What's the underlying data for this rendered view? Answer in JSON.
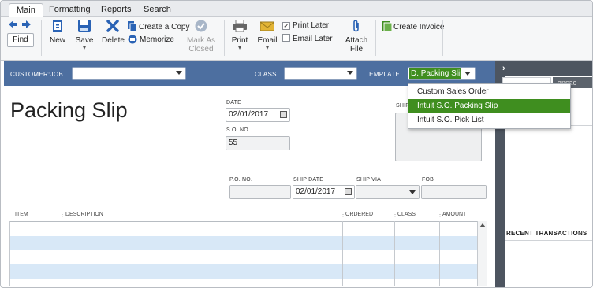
{
  "tabs": [
    "Main",
    "Formatting",
    "Reports",
    "Search"
  ],
  "toolbar": {
    "find": "Find",
    "new": "New",
    "save": "Save",
    "delete": "Delete",
    "create_a_copy": "Create a Copy",
    "memorize": "Memorize",
    "mark_as_closed_1": "Mark As",
    "mark_as_closed_2": "Closed",
    "print": "Print",
    "email": "Email",
    "print_later": "Print Later",
    "email_later": "Email Later",
    "attach_file_1": "Attach",
    "attach_file_2": "File",
    "create_invoice": "Create Invoice"
  },
  "header": {
    "customer_job_label": "CUSTOMER:JOB",
    "class_label": "CLASS",
    "template_label": "TEMPLATE",
    "template_value": "D. Packing Slip"
  },
  "template_options": [
    "Custom Sales Order",
    "Intuit S.O. Packing Slip",
    "Intuit S.O. Pick List"
  ],
  "form": {
    "title": "Packing Slip",
    "date_label": "DATE",
    "date_value": "02/01/2017",
    "so_no_label": "S.O. NO.",
    "so_no_value": "55",
    "ship_to_label": "SHIP",
    "po_no_label": "P.O. NO.",
    "ship_date_label": "SHIP DATE",
    "ship_date_value": "02/01/2017",
    "ship_via_label": "SHIP VIA",
    "fob_label": "FOB"
  },
  "table": {
    "columns": [
      "ITEM",
      "DESCRIPTION",
      "ORDERED",
      "CLASS",
      "AMOUNT"
    ]
  },
  "right_panel": {
    "tab_label": "ansac",
    "recent_transactions": "RECENT TRANSACTIONS"
  },
  "colors": {
    "header_bar": "#4d6fa0",
    "selection_green": "#3f8e1f",
    "row_alt": "#d8e8f7"
  }
}
